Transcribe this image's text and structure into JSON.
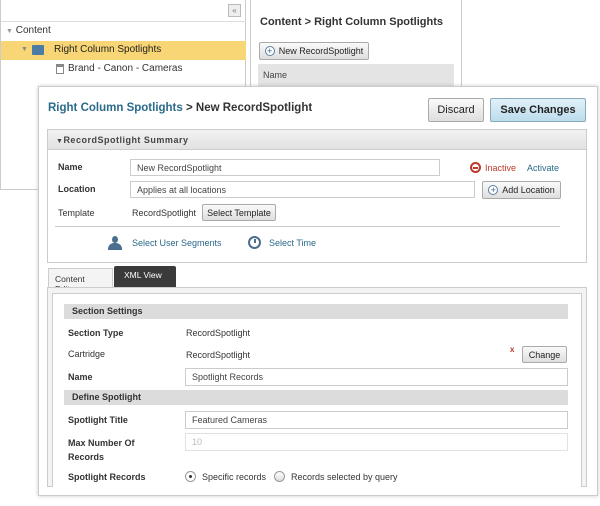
{
  "tree": {
    "root": "Content",
    "selected": "Right Column Spotlights",
    "child": "Brand - Canon - Cameras",
    "collapse_icon": "double-chevron-left-icon"
  },
  "list_panel": {
    "breadcrumb": "Content > Right Column Spotlights",
    "new_button": "New RecordSpotlight",
    "column_name": "Name"
  },
  "editor": {
    "breadcrumb_parent": "Right Column Spotlights",
    "breadcrumb_current": "> New RecordSpotlight",
    "discard": "Discard",
    "save": "Save Changes",
    "summary": {
      "title": "RecordSpotlight Summary",
      "name_label": "Name",
      "name_value": "New RecordSpotlight",
      "status": "Inactive",
      "activate": "Activate",
      "location_label": "Location",
      "location_value": "Applies at all locations",
      "add_location": "Add Location",
      "template_label": "Template",
      "template_value": "RecordSpotlight",
      "select_template": "Select Template",
      "select_segments": "Select User Segments",
      "select_time": "Select Time"
    },
    "tabs": [
      {
        "label": "Content Editor",
        "active": false
      },
      {
        "label": "XML View",
        "active": true
      }
    ],
    "section_settings": {
      "header": "Section Settings",
      "section_type_label": "Section Type",
      "section_type_value": "RecordSpotlight",
      "cartridge_label": "Cartridge",
      "cartridge_value": "RecordSpotlight",
      "remove": "x",
      "change": "Change",
      "name_label": "Name",
      "name_value": "Spotlight Records"
    },
    "define_spotlight": {
      "header": "Define Spotlight",
      "title_label": "Spotlight Title",
      "title_value": "Featured Cameras",
      "max_label": "Max Number Of Records",
      "max_placeholder": "10",
      "records_label": "Spotlight Records",
      "option_specific": "Specific records",
      "option_query": "Records selected by query",
      "selected_option": "Specific records"
    }
  },
  "colors": {
    "highlight": "#f8d675",
    "link": "#2a6a8a",
    "save_button": "#cfe6f3",
    "tab_active": "#3a3a3a",
    "inactive": "#c0392b"
  }
}
